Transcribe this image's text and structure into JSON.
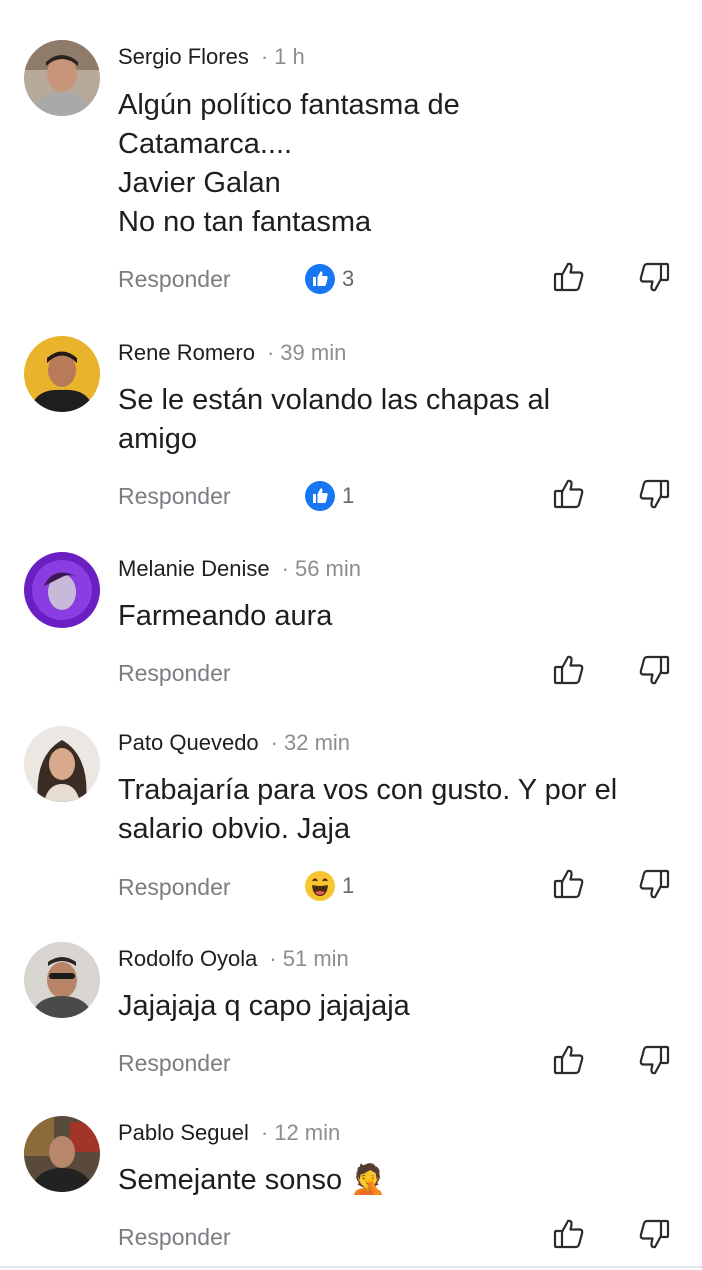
{
  "comments": [
    {
      "author": "Sergio Flores",
      "time": "1 h",
      "lines": [
        "Algún político fantasma de",
        "Catamarca....",
        "Javier Galan",
        "No no tan fantasma"
      ],
      "reply_label": "Responder",
      "reaction": {
        "icon": "like-reaction-icon",
        "count": "3"
      }
    },
    {
      "author": "Rene Romero",
      "time": "39 min",
      "lines": [
        "Se le están volando las chapas al",
        "amigo"
      ],
      "reply_label": "Responder",
      "reaction": {
        "icon": "like-reaction-icon",
        "count": "1"
      }
    },
    {
      "author": "Melanie Denise",
      "time": "56 min",
      "lines": [
        "Farmeando aura"
      ],
      "reply_label": "Responder",
      "reaction": null
    },
    {
      "author": "Pato Quevedo",
      "time": "32 min",
      "lines": [
        "Trabajaría para vos con gusto. Y por el",
        "salario obvio. Jaja"
      ],
      "reply_label": "Responder",
      "reaction": {
        "icon": "haha-reaction-icon",
        "count": "1"
      }
    },
    {
      "author": "Rodolfo Oyola",
      "time": "51 min",
      "lines": [
        "Jajajaja q capo jajajaja"
      ],
      "reply_label": "Responder",
      "reaction": null
    },
    {
      "author": "Pablo Seguel",
      "time": "12 min",
      "lines": [
        "Semejante sonso"
      ],
      "emoji": "🤦",
      "reply_label": "Responder",
      "reaction": null
    }
  ],
  "colors": {
    "like_blue": "#1877f2",
    "text": "#1c1e21",
    "secondary": "#8a8d91"
  }
}
